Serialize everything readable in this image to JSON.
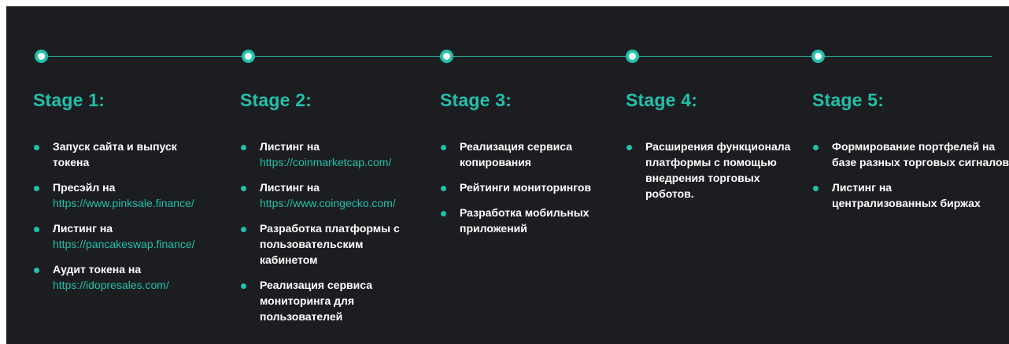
{
  "colors": {
    "background": "#1c1d21",
    "accent": "#22c1aa",
    "text": "#ffffff"
  },
  "stages": [
    {
      "title": "Stage 1:",
      "items": [
        {
          "text": "Запуск сайта и выпуск токена",
          "link": ""
        },
        {
          "text": "Пресэйл на",
          "link": "https://www.pinksale.finance/"
        },
        {
          "text": "Листинг на",
          "link": "https://pancakeswap.finance/"
        },
        {
          "text": "Аудит токена на",
          "link": "https://idopresales.com/"
        }
      ]
    },
    {
      "title": "Stage 2:",
      "items": [
        {
          "text": "Листинг на",
          "link": "https://coinmarketcap.com/"
        },
        {
          "text": "Листинг на",
          "link": "https://www.coingecko.com/"
        },
        {
          "text": "Разработка платформы с пользовательским кабинетом",
          "link": ""
        },
        {
          "text": "Реализация сервиса мониторинга для пользователей",
          "link": ""
        }
      ]
    },
    {
      "title": "Stage 3:",
      "items": [
        {
          "text": "Реализация сервиса копирования",
          "link": ""
        },
        {
          "text": "Рейтинги мониторингов",
          "link": ""
        },
        {
          "text": "Разработка мобильных приложений",
          "link": ""
        }
      ]
    },
    {
      "title": "Stage 4:",
      "items": [
        {
          "text": "Расширения функционала платформы с помощью внедрения торговых роботов.",
          "link": ""
        }
      ]
    },
    {
      "title": "Stage 5:",
      "items": [
        {
          "text": "Формирование портфелей на базе разных торговых сигналов",
          "link": ""
        },
        {
          "text": "Листинг на централизованных биржах",
          "link": ""
        }
      ]
    }
  ]
}
